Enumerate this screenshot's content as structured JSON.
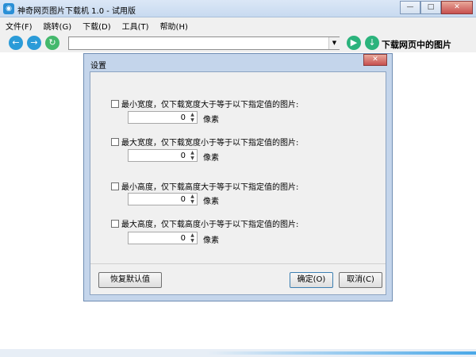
{
  "window": {
    "title": "神奇网页图片下载机 1.0 - 试用版",
    "controls": {
      "minimize": "—",
      "maximize": "□",
      "close": "✕"
    }
  },
  "menu": [
    "文件(F)",
    "跳转(G)",
    "下载(D)",
    "工具(T)",
    "帮助(H)"
  ],
  "toolbar": {
    "url_value": "",
    "download_label": "下载网页中的图片",
    "icons": {
      "back": "←",
      "forward": "→",
      "refresh": "↻",
      "dropdown": "▼",
      "go": "▶",
      "download": "↓"
    }
  },
  "dialog": {
    "title": "设置",
    "close": "✕",
    "rows": [
      {
        "label": "最小宽度，仅下载宽度大于等于以下指定值的图片:",
        "value": "0",
        "unit": "像素"
      },
      {
        "label": "最大宽度，仅下载宽度小于等于以下指定值的图片:",
        "value": "0",
        "unit": "像素"
      },
      {
        "label": "最小高度，仅下载高度大于等于以下指定值的图片:",
        "value": "0",
        "unit": "像素"
      },
      {
        "label": "最大高度，仅下载高度小于等于以下指定值的图片:",
        "value": "0",
        "unit": "像素"
      }
    ],
    "buttons": {
      "restore": "恢复默认值",
      "ok": "确定(O)",
      "cancel": "取消(C)"
    }
  }
}
